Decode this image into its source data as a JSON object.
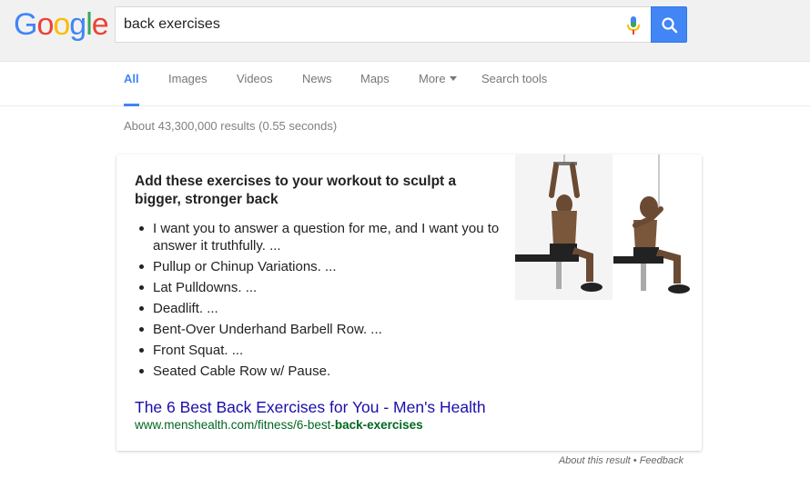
{
  "logo": {
    "letters": [
      "G",
      "o",
      "o",
      "g",
      "l",
      "e"
    ],
    "colors": [
      "#4285f4",
      "#ea4335",
      "#fbbc05",
      "#4285f4",
      "#34a853",
      "#ea4335"
    ]
  },
  "search": {
    "query": "back exercises",
    "mic_icon": "microphone-icon",
    "button_icon": "search-icon"
  },
  "nav": {
    "tabs": [
      "All",
      "Images",
      "Videos",
      "News",
      "Maps"
    ],
    "more": "More",
    "tools": "Search tools",
    "accent": "#4285f4"
  },
  "stats": "About 43,300,000 results (0.55 seconds)",
  "snippet": {
    "title": "Add these exercises to your workout to sculpt a bigger, stronger back",
    "items": [
      "I want you to answer a question for me, and I want you to answer it truthfully. ...",
      "Pullup or Chinup Variations. ...",
      "Lat Pulldowns. ...",
      "Deadlift. ...",
      "Bent-Over Underhand Barbell Row. ...",
      "Front Squat. ...",
      "Seated Cable Row w/ Pause."
    ],
    "link_text": "The 6 Best Back Exercises for You - Men's Health",
    "url_prefix": "www.menshealth.com/fitness/6-best-",
    "url_bold_1": "back",
    "url_dash": "-",
    "url_bold_2": "exercises"
  },
  "footer": {
    "about": "About this result",
    "sep": " • ",
    "feedback": "Feedback"
  }
}
